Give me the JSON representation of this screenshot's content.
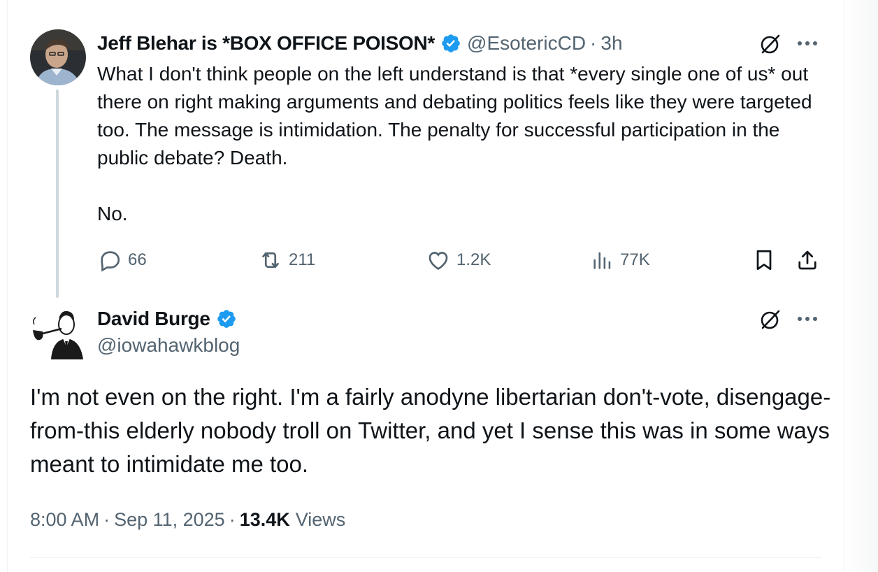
{
  "parent_tweet": {
    "author_name": "Jeff Blehar is *BOX OFFICE POISON*",
    "handle": "@EsotericCD",
    "separator": "·",
    "time_ago": "3h",
    "text": "What I don't think people on the left understand is that *every single one of us* out there on right making arguments and debating politics feels like they were targeted too. The message is intimidation. The penalty for successful participation in the public debate? Death.\n\nNo.",
    "stats": {
      "replies": "66",
      "reposts": "211",
      "likes": "1.2K",
      "views": "77K"
    },
    "icons": {
      "grok": "grok-icon",
      "more": "more-icon",
      "reply": "reply-icon",
      "repost": "repost-icon",
      "like": "like-icon",
      "views": "views-icon",
      "bookmark": "bookmark-icon",
      "share": "share-icon"
    }
  },
  "main_tweet": {
    "author_name": "David Burge",
    "handle": "@iowahawkblog",
    "text": "I'm not even on the right. I'm a fairly anodyne libertarian don't-vote, disengage-from-this elderly nobody troll on Twitter, and yet I sense this was in some ways meant to intimidate me too.",
    "time": "8:00 AM",
    "date": "Sep 11, 2025",
    "separator": "·",
    "views_count": "13.4K",
    "views_label": "Views"
  },
  "colors": {
    "text_primary": "#0f1419",
    "text_secondary": "#536471",
    "verified_blue": "#1d9bf0",
    "thread_line": "#cfd9de",
    "divider": "#eff3f4"
  }
}
